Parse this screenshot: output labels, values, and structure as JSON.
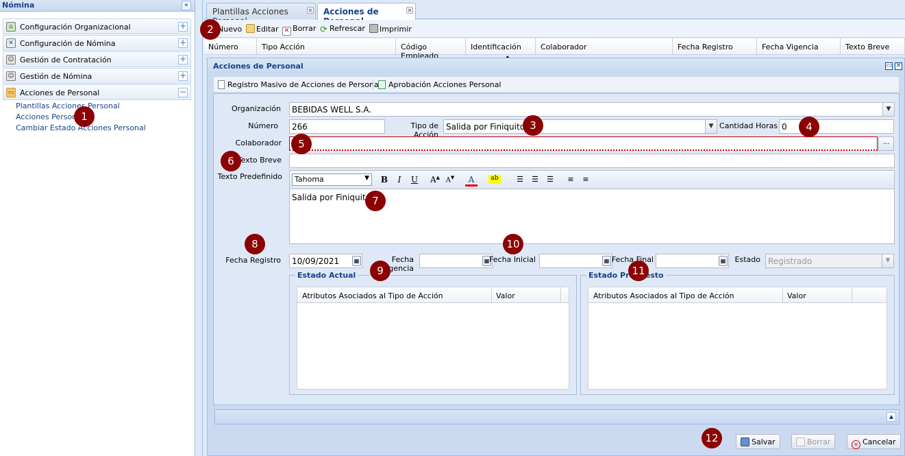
{
  "left_panel": {
    "title": "Nómina",
    "groups": [
      {
        "label": "Configuración Organizacional"
      },
      {
        "label": "Configuración de Nómina"
      },
      {
        "label": "Gestión de Contratación"
      },
      {
        "label": "Gestión de Nómina"
      },
      {
        "label": "Acciones de Personal"
      }
    ],
    "sub_items": [
      "Plantillas Acciones Personal",
      "Acciones Personal",
      "Cambiar Estado Acciones Personal"
    ]
  },
  "tabs": [
    {
      "label": "Plantillas Acciones Personal",
      "active": false
    },
    {
      "label": "Acciones de Personal",
      "active": true
    }
  ],
  "toolbar": {
    "new": "Nuevo",
    "edit": "Editar",
    "delete": "Borrar",
    "refresh": "Refrescar",
    "print": "Imprimir"
  },
  "grid": {
    "columns": [
      "Número",
      "Tipo Acción",
      "Código Empleado",
      "Identificación",
      "Colaborador",
      "Fecha Registro",
      "Fecha Vigencia",
      "Texto Breve"
    ]
  },
  "window": {
    "title": "Acciones de Personal",
    "sub_toolbar": {
      "bulk": "Registro Masivo de Acciones de Personal",
      "approve": "Aprobación Acciones Personal"
    }
  },
  "form": {
    "organizacion_label": "Organización",
    "organizacion_value": "BEBIDAS WELL S.A.",
    "numero_label": "Número",
    "numero_value": "266",
    "tipo_accion_label": "Tipo de Acción",
    "tipo_accion_value": "Salida por Finiquito",
    "cantidad_horas_label": "Cantidad Horas",
    "cantidad_horas_value": "0",
    "colaborador_label": "Colaborador",
    "colaborador_value": "",
    "colaborador_button": "...",
    "texto_breve_label": "Texto Breve",
    "texto_breve_value": "",
    "texto_predefinido_label": "Texto Predefinido",
    "editor_font": "Tahoma",
    "editor_content": "Salida por Finiquito",
    "fecha_registro_label": "Fecha Registro",
    "fecha_registro_value": "10/09/2021",
    "fecha_vigencia_label": "Fecha Vigencia",
    "fecha_vigencia_value": "",
    "fecha_inicial_label": "Fecha Inicial",
    "fecha_inicial_value": "",
    "fecha_final_label": "Fecha Final",
    "fecha_final_value": "",
    "estado_label": "Estado",
    "estado_value": "Registrado"
  },
  "estado_actual": {
    "legend": "Estado Actual",
    "columns": [
      "Atributos Asociados al Tipo de Acción",
      "Valor"
    ]
  },
  "estado_propuesto": {
    "legend": "Estado Propuesto",
    "columns": [
      "Atributos Asociados al Tipo de Acción",
      "Valor"
    ]
  },
  "footer": {
    "save": "Salvar",
    "delete": "Borrar",
    "cancel": "Cancelar"
  },
  "markers": [
    "1",
    "2",
    "3",
    "4",
    "5",
    "6",
    "7",
    "8",
    "9",
    "10",
    "11",
    "12"
  ],
  "colors": {
    "accent": "#15428b",
    "marker": "#8b0000",
    "panel_bg": "#dfe8f6"
  }
}
